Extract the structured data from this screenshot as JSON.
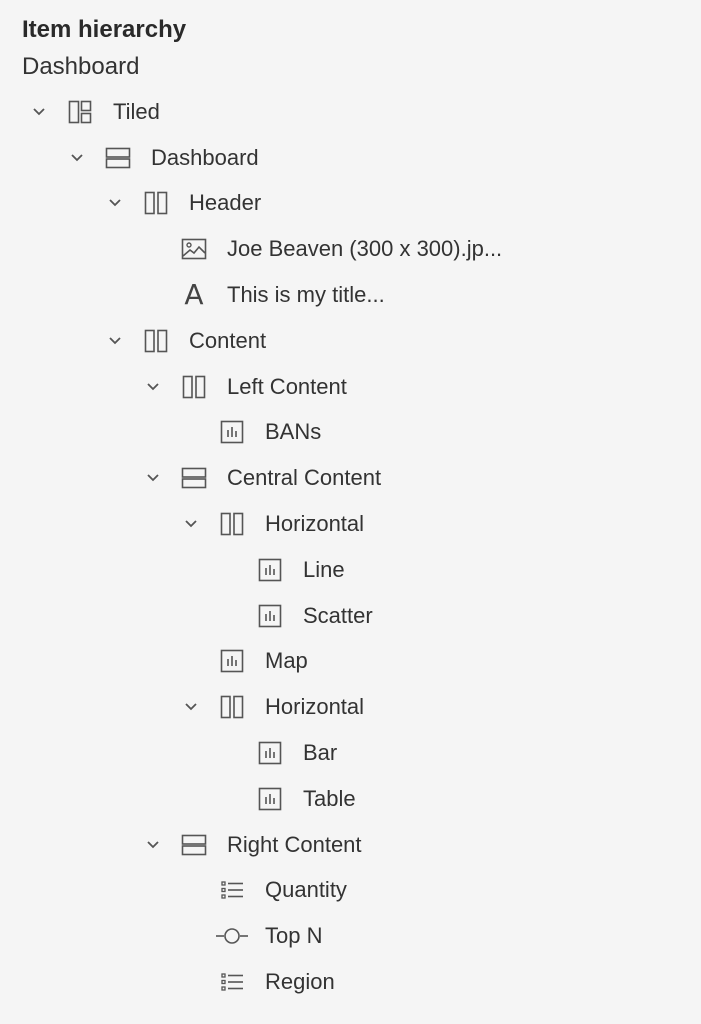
{
  "panel": {
    "title": "Item hierarchy",
    "subtitle": "Dashboard"
  },
  "tree": [
    {
      "label": "Tiled",
      "depth": 0,
      "icon": "tiled-layout-icon",
      "expanded": true
    },
    {
      "label": "Dashboard",
      "depth": 1,
      "icon": "vertical-container-icon",
      "expanded": true
    },
    {
      "label": "Header",
      "depth": 2,
      "icon": "horizontal-container-icon",
      "expanded": true
    },
    {
      "label": "Joe Beaven (300 x 300).jp...",
      "depth": 3,
      "icon": "image-icon"
    },
    {
      "label": "This is my title...",
      "depth": 3,
      "icon": "text-icon"
    },
    {
      "label": "Content",
      "depth": 2,
      "icon": "horizontal-container-icon",
      "expanded": true
    },
    {
      "label": "Left Content",
      "depth": 3,
      "icon": "horizontal-container-icon",
      "expanded": true
    },
    {
      "label": "BANs",
      "depth": 4,
      "icon": "sheet-icon"
    },
    {
      "label": "Central Content",
      "depth": 3,
      "icon": "vertical-container-icon",
      "expanded": true
    },
    {
      "label": "Horizontal",
      "depth": 4,
      "icon": "horizontal-container-icon",
      "expanded": true
    },
    {
      "label": "Line",
      "depth": 5,
      "icon": "sheet-icon"
    },
    {
      "label": "Scatter",
      "depth": 5,
      "icon": "sheet-icon"
    },
    {
      "label": "Map",
      "depth": 4,
      "icon": "sheet-icon"
    },
    {
      "label": "Horizontal",
      "depth": 4,
      "icon": "horizontal-container-icon",
      "expanded": true
    },
    {
      "label": "Bar",
      "depth": 5,
      "icon": "sheet-icon"
    },
    {
      "label": "Table",
      "depth": 5,
      "icon": "sheet-icon"
    },
    {
      "label": "Right Content",
      "depth": 3,
      "icon": "vertical-container-icon",
      "expanded": true
    },
    {
      "label": "Quantity",
      "depth": 4,
      "icon": "filter-list-icon"
    },
    {
      "label": "Top N",
      "depth": 4,
      "icon": "parameter-icon"
    },
    {
      "label": "Region",
      "depth": 4,
      "icon": "filter-list-icon"
    }
  ]
}
